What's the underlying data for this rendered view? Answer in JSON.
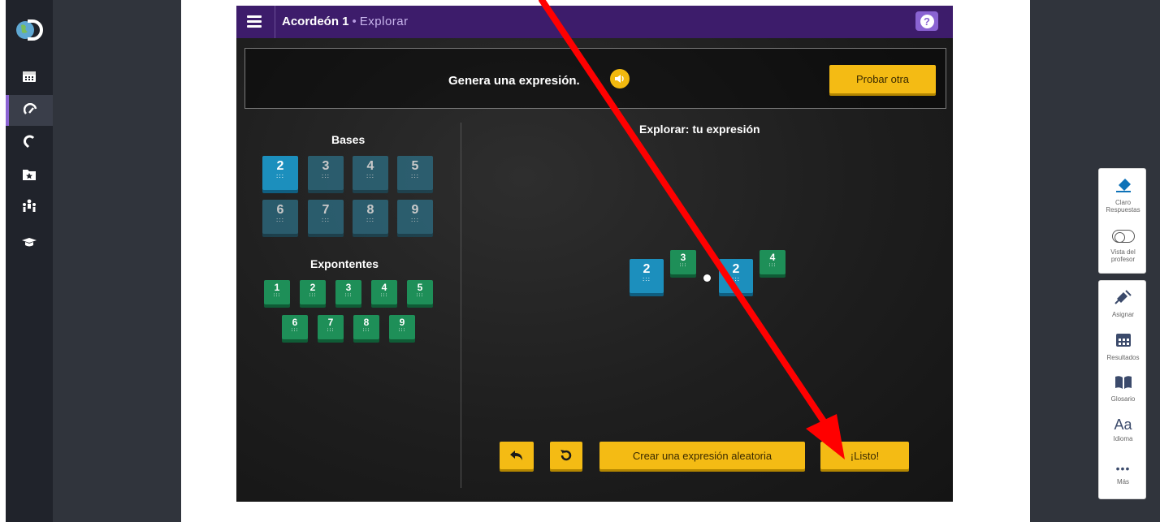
{
  "app": {
    "title": "Acordeón 1",
    "mode": "Explorar",
    "help_icon": "question-icon"
  },
  "prompt": {
    "text": "Genera una expresión.",
    "speaker_icon": "speaker-icon",
    "new_button": "Probar otra"
  },
  "bases": {
    "title": "Bases",
    "tiles": [
      "2",
      "3",
      "4",
      "5",
      "6",
      "7",
      "8",
      "9"
    ],
    "selected": "2"
  },
  "exponents": {
    "title": "Expontentes",
    "tiles": [
      "1",
      "2",
      "3",
      "4",
      "5",
      "6",
      "7",
      "8",
      "9"
    ]
  },
  "explore": {
    "title": "Explorar: tu expresión",
    "expression": {
      "base1": "2",
      "exp1": "3",
      "base2": "2",
      "exp2": "4"
    }
  },
  "actions": {
    "undo_icon": "undo-icon",
    "reset_icon": "reset-icon",
    "random_label": "Crear una expresión aleatoria",
    "done_label": "¡Listo!"
  },
  "tools": {
    "clear": {
      "line1": "Claro",
      "line2": "Respuestas"
    },
    "teacher_view": {
      "line1": "Vista del",
      "line2": "profesor"
    },
    "assign": "Asignar",
    "results": "Resultados",
    "glossary": "Glosario",
    "language_glyph": "Aa",
    "language": "Idioma",
    "more": "Más"
  },
  "colors": {
    "topbar": "#3d1c6b",
    "accent_yellow": "#f4bb14",
    "base_tile": "#1c8fbd",
    "exponent_tile": "#1e8f58",
    "arrow": "#ff0000"
  }
}
